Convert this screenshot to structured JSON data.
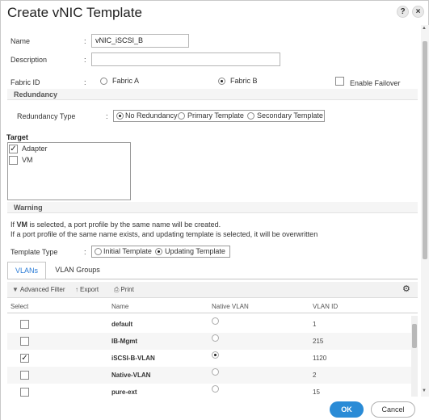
{
  "dialog": {
    "title": "Create vNIC Template",
    "help_label": "?",
    "close_label": "×"
  },
  "form": {
    "name_label": "Name",
    "name_value": "vNIC_iSCSI_B",
    "description_label": "Description",
    "description_value": "",
    "fabric_id_label": "Fabric ID",
    "fabric_a_label": "Fabric A",
    "fabric_b_label": "Fabric B",
    "fabric_selected": "Fabric B",
    "enable_failover_label": "Enable Failover",
    "enable_failover_checked": false,
    "colon": ":"
  },
  "redundancy": {
    "section_title": "Redundancy",
    "type_label": "Redundancy Type",
    "options": [
      "No Redundancy",
      "Primary Template",
      "Secondary Template"
    ],
    "selected": "No Redundancy"
  },
  "target": {
    "label": "Target",
    "items": [
      {
        "label": "Adapter",
        "checked": true
      },
      {
        "label": "VM",
        "checked": false
      }
    ]
  },
  "warning": {
    "section_title": "Warning",
    "line1_prefix": "If ",
    "line1_bold": "VM",
    "line1_suffix": " is selected, a port profile by the same name will be created.",
    "line2": "If a port profile of the same name exists, and updating template is selected, it will be overwritten"
  },
  "template_type": {
    "label": "Template Type",
    "options": [
      "Initial Template",
      "Updating Template"
    ],
    "selected": "Updating Template"
  },
  "tabs": [
    {
      "label": "VLANs",
      "active": true
    },
    {
      "label": "VLAN Groups",
      "active": false
    }
  ],
  "toolbar": {
    "advanced_filter_label": "Advanced Filter",
    "export_label": "Export",
    "print_label": "Print"
  },
  "vlan_table": {
    "columns": [
      "Select",
      "Name",
      "Native VLAN",
      "VLAN ID"
    ],
    "rows": [
      {
        "select": false,
        "name": "default",
        "native": false,
        "vlan_id": "1"
      },
      {
        "select": false,
        "name": "IB-Mgmt",
        "native": false,
        "vlan_id": "215"
      },
      {
        "select": true,
        "name": "iSCSI-B-VLAN",
        "native": true,
        "vlan_id": "1120"
      },
      {
        "select": false,
        "name": "Native-VLAN",
        "native": false,
        "vlan_id": "2"
      },
      {
        "select": false,
        "name": "pure-ext",
        "native": false,
        "vlan_id": "15"
      }
    ]
  },
  "footer": {
    "ok_label": "OK",
    "cancel_label": "Cancel"
  },
  "colors": {
    "accent": "#2a8bd6",
    "tab_active_text": "#2a7bd6",
    "section_bg": "#f5f5f5"
  }
}
